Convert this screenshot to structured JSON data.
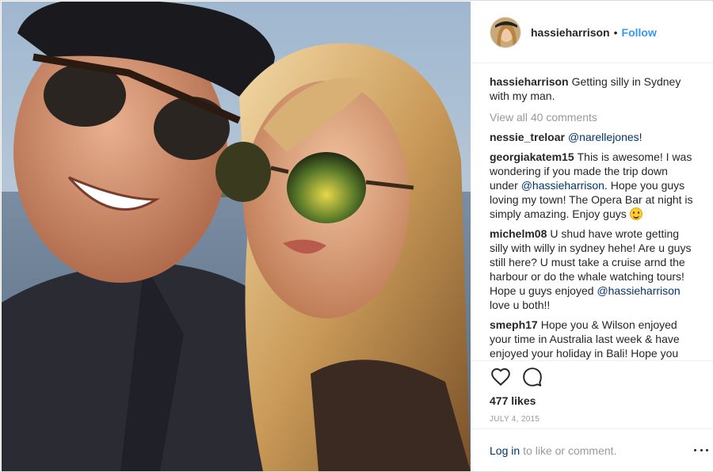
{
  "post": {
    "author": "hassieharrison",
    "follow_separator": "•",
    "follow_label": "Follow",
    "photo": "sunset-selfie-photo"
  },
  "caption": {
    "user": "hassieharrison",
    "text": "Getting silly in Sydney with my man."
  },
  "view_all": "View all 40 comments",
  "comments": [
    {
      "user": "nessie_treloar",
      "mention": "@narellejones",
      "text_after": "!"
    },
    {
      "user": "georgiakatem15",
      "text_before": "This is awesome! I was wondering if you made the trip down under",
      "mention": "@hassieharrison",
      "text_after": ". Hope you guys loving my town! The Opera Bar at night is simply amazing. Enjoy guys",
      "emoji": "smiley-emoji"
    },
    {
      "user": "michelm08",
      "text_before": "U shud have wrote getting silly with willy in sydney hehe! Are u guys still here? U must take a cruise arnd the harbour or do the whale watching tours! Hope u guys enjoyed",
      "mention": "@hassieharrison",
      "text_after": "love u both!!"
    },
    {
      "user": "smeph17",
      "text_before": "Hope you & Wilson enjoyed your time in Australia last week & have enjoyed your holiday in Bali! Hope you both can visit us all soon again"
    }
  ],
  "actions": {
    "like_icon": "heart-icon",
    "comment_icon": "comment-icon"
  },
  "likes": "477 likes",
  "date": "JULY 4, 2015",
  "footer": {
    "login": "Log in",
    "rest": "to like or comment.",
    "more_icon": "more-options-icon"
  },
  "colors": {
    "link_blue": "#3897f0",
    "mention_navy": "#003569",
    "muted_gray": "#999999",
    "text_dark": "#262626"
  }
}
